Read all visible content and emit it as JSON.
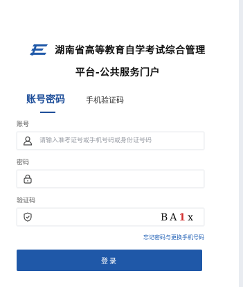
{
  "brand": {
    "title_line1": "湖南省高等教育自学考试综合管理",
    "title_line2": "平台-公共服务门户",
    "accent_color": "#1f58a8"
  },
  "tabs": [
    {
      "label": "账号密码",
      "active": true
    },
    {
      "label": "手机验证码",
      "active": false
    }
  ],
  "form": {
    "account": {
      "label": "账号",
      "placeholder": "请输入准考证号或手机号码或身份证号码",
      "value": "",
      "icon": "user-icon"
    },
    "password": {
      "label": "密码",
      "placeholder": "",
      "value": "",
      "icon": "lock-icon"
    },
    "captcha": {
      "label": "验证码",
      "placeholder": "",
      "value": "",
      "icon": "shield-icon",
      "image_text": {
        "part1": "BA",
        "part2": "1",
        "part3": "x"
      }
    }
  },
  "forgot_link": "忘记密码与更换手机号码",
  "login_button": "登录"
}
